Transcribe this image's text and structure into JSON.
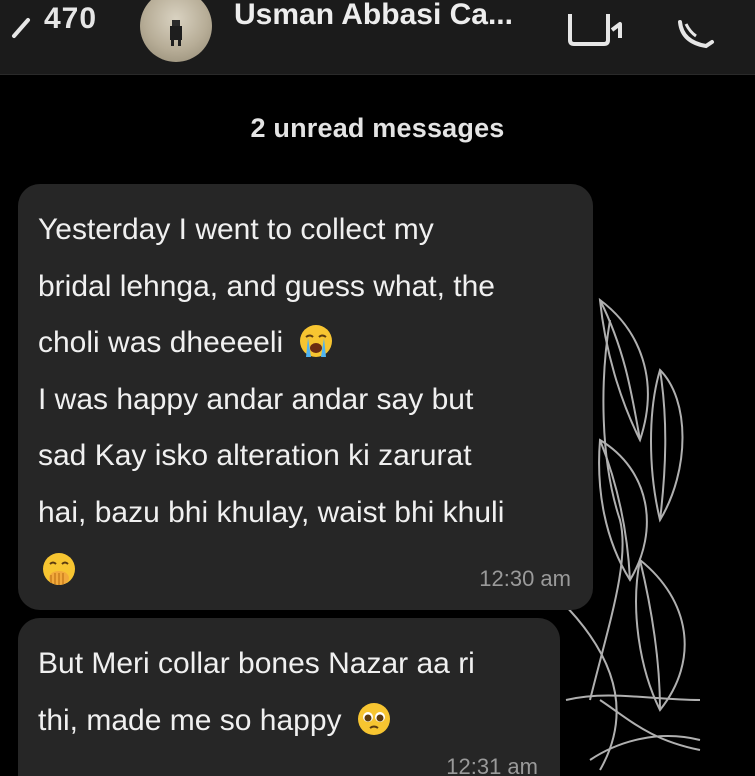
{
  "header": {
    "back_count": "470",
    "contact_name": "Usman Abbasi Ca...",
    "icons": {
      "back": "chevron-left-icon",
      "video": "video-call-icon",
      "call": "phone-call-icon"
    }
  },
  "chat": {
    "unread_banner": "2 unread messages",
    "messages": [
      {
        "lines": [
          "Yesterday I went to collect my",
          "bridal lehnga, and guess what, the",
          "choli was dheeeeli",
          "I was happy andar andar say but",
          "sad Kay isko alteration ki zarurat",
          "hai, bazu bhi khulay, waist bhi khuli"
        ],
        "emojis": [
          "loudly-crying-face-icon",
          "face-with-hand-over-mouth-icon"
        ],
        "time": "12:30 am"
      },
      {
        "lines": [
          "But Meri collar bones Nazar aa ri",
          "thi, made me so happy"
        ],
        "emojis": [
          "pleading-face-icon"
        ],
        "time": "12:31 am"
      }
    ]
  },
  "colors": {
    "background": "#000000",
    "header": "#1b1b1b",
    "bubble": "#262626",
    "text": "#f0f0f0",
    "timestamp": "#9a9a9a"
  }
}
